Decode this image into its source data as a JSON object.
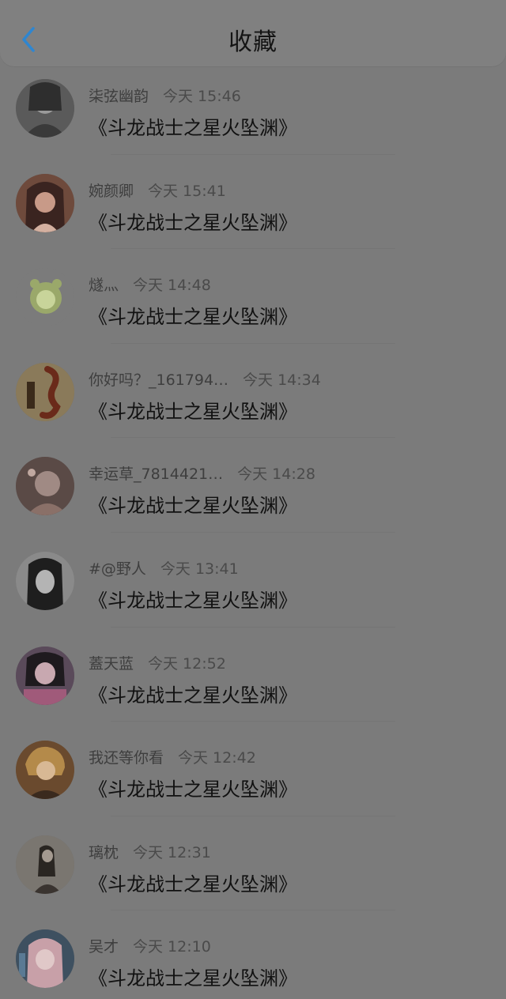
{
  "header": {
    "title": "收藏",
    "back_icon": "chevron-left-icon",
    "accent": "#2f86d0"
  },
  "items": [
    {
      "name": "柒弦幽韵",
      "time": "今天 15:46",
      "book": "《斗龙战士之星火坠渊》",
      "avatar_color": "#5a5a5a"
    },
    {
      "name": "婉颜卿",
      "time": "今天 15:41",
      "book": "《斗龙战士之星火坠渊》",
      "avatar_color": "#6e4a3c"
    },
    {
      "name": "燧灬",
      "time": "今天 14:48",
      "book": "《斗龙战士之星火坠渊》",
      "avatar_color": "#7c8a5a"
    },
    {
      "name": "你好吗？_161794…",
      "time": "今天 14:34",
      "book": "《斗龙战士之星火坠渊》",
      "avatar_color": "#8a6a4a"
    },
    {
      "name": "幸运草_7814421…",
      "time": "今天 14:28",
      "book": "《斗龙战士之星火坠渊》",
      "avatar_color": "#6a5550"
    },
    {
      "name": "#@野人",
      "time": "今天 13:41",
      "book": "《斗龙战士之星火坠渊》",
      "avatar_color": "#4a4a4a"
    },
    {
      "name": "蓋天蓝",
      "time": "今天 12:52",
      "book": "《斗龙战士之星火坠渊》",
      "avatar_color": "#6a4a5a"
    },
    {
      "name": "我还等你看",
      "time": "今天 12:42",
      "book": "《斗龙战士之星火坠渊》",
      "avatar_color": "#7a5a3a"
    },
    {
      "name": "璃枕",
      "time": "今天 12:31",
      "book": "《斗龙战士之星火坠渊》",
      "avatar_color": "#5e5a56"
    },
    {
      "name": "吴才",
      "time": "今天 12:10",
      "book": "《斗龙战士之星火坠渊》",
      "avatar_color": "#4a5a6a"
    }
  ]
}
